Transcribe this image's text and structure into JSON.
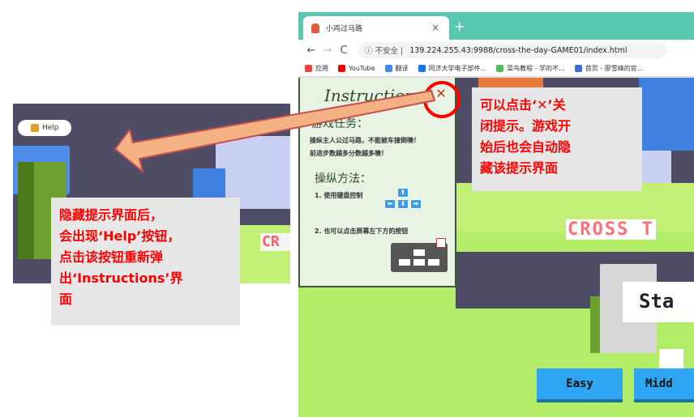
{
  "left_screenshot": {
    "help_button_label": "Help",
    "title_fragment": "CR"
  },
  "left_callout": {
    "lines": [
      "隐藏提示界面后，",
      "会出现‘Help’按钮，",
      "点击该按钮重新弹",
      "出‘Instructions’界",
      "面"
    ]
  },
  "browser": {
    "tab_title": "小鸡过马路",
    "tab_close": "×",
    "new_tab": "+",
    "nav_back": "←",
    "nav_forward": "→",
    "nav_reload": "C",
    "url_insecure": "ⓘ 不安全 |",
    "url": "139.224.255.43:9988/cross-the-day-GAME01/index.html",
    "bookmarks": [
      {
        "label": "应用",
        "color": "#e8453c"
      },
      {
        "label": "YouTube",
        "color": "#ff0000"
      },
      {
        "label": "翻译",
        "color": "#4285f4"
      },
      {
        "label": "同济大学电子部件...",
        "color": "#1a73e8"
      },
      {
        "label": "菜鸟教程 - 学的不...",
        "color": "#5cb85c"
      },
      {
        "label": "首页 - 廖雪峰的官...",
        "color": "#3b6fd8"
      }
    ]
  },
  "instructions": {
    "title": "Instructions",
    "close_symbol": "✕",
    "task_heading": "游戏任务：",
    "task_text_1": "操纵主人公过马路，不能被车撞倒噢！",
    "task_text_2": "前进步数越多分数越多噢！",
    "control_heading": "操纵方法：",
    "step1": "1.  使用键盘控制",
    "step2": "2.  也可以点击屏幕左下方的按钮",
    "keys": {
      "up": "⬆",
      "left": "⬅",
      "down": "⬇",
      "right": "➡"
    }
  },
  "game": {
    "title_text": "CROSS T",
    "start_text": "Sta",
    "easy_label": "Easy",
    "middle_label": "Midd"
  },
  "right_callout": {
    "line1_a": "可以点击‘",
    "line1_x": "✕",
    "line1_b": "’关",
    "lines": [
      "闭提示。游戏开",
      "始后也会自动隐",
      "藏该提示界面"
    ]
  },
  "colors": {
    "annotation_red": "#ff0000",
    "arrow_fill": "#f4b183",
    "arrow_stroke": "#c0504d",
    "tabbar": "#5ac7b1",
    "button_blue": "#2fa6f2"
  }
}
